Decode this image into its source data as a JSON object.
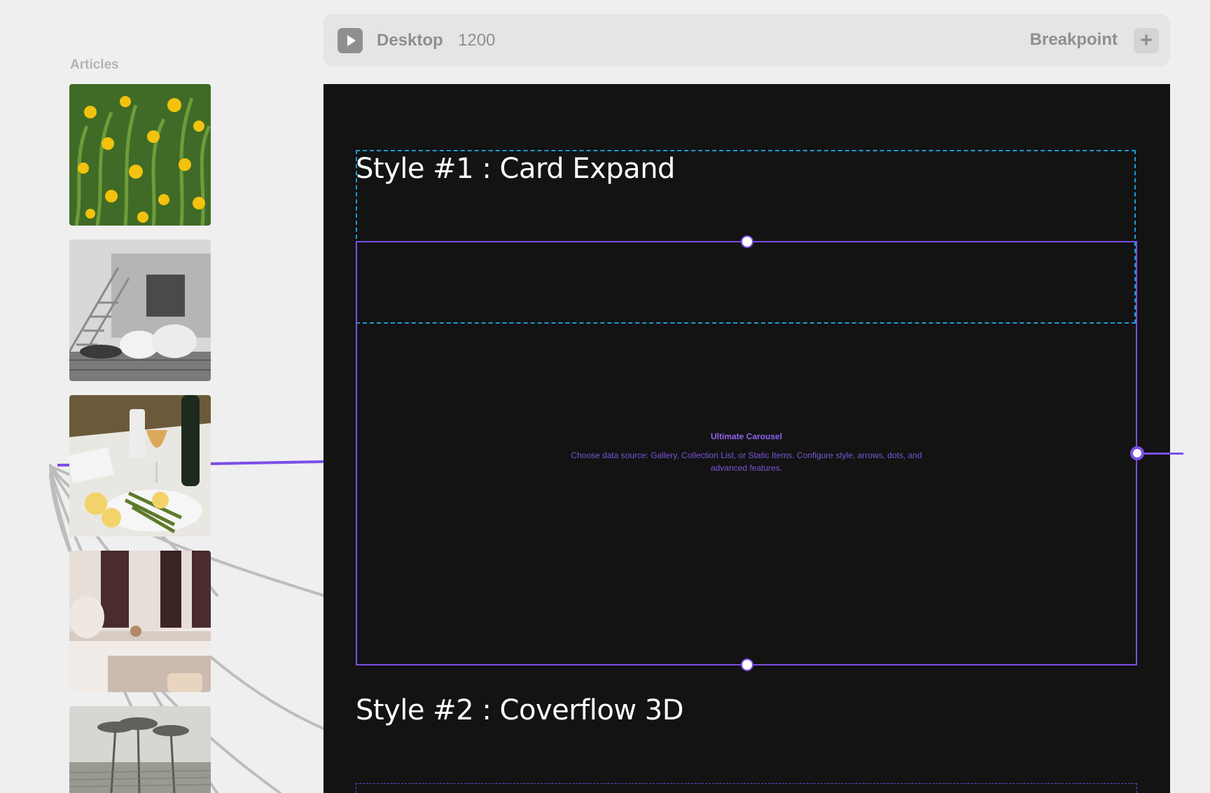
{
  "sidebar": {
    "label": "Articles",
    "thumbnails": [
      {
        "name": "dandelion-field-image"
      },
      {
        "name": "dogs-on-deck-image"
      },
      {
        "name": "dinner-table-image"
      },
      {
        "name": "marble-bathroom-image"
      },
      {
        "name": "palm-trees-image"
      }
    ]
  },
  "breakpoint_bar": {
    "play_icon": "play-icon",
    "name": "Desktop",
    "width": "1200",
    "breakpoint_label": "Breakpoint",
    "add_icon": "plus-icon"
  },
  "canvas": {
    "style1_heading": "Style #1 : Card Expand",
    "carousel_title": "Ultimate Carousel",
    "carousel_desc": "Choose data source: Gallery, Collection List, or Static Items. Configure style, arrows, dots, and advanced features.",
    "style2_heading": "Style #2 : Coverflow 3D"
  },
  "colors": {
    "page_bg": "#efefef",
    "canvas_bg": "#131313",
    "accent_purple": "#7b4fe6",
    "selection_blue": "#1b9bd7",
    "muted_text": "#8f8f8f"
  }
}
